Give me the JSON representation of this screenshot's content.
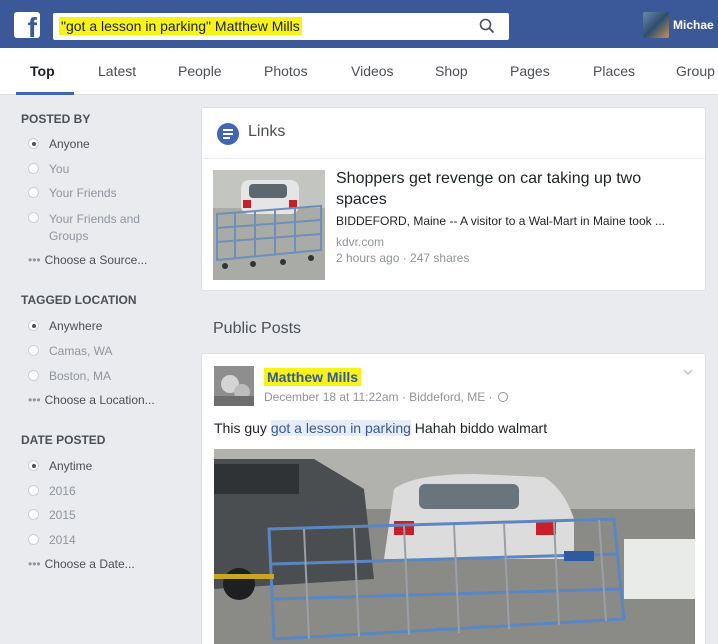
{
  "header": {
    "logo": "f",
    "search_query": "\"got a lesson in parking\" Matthew Mills",
    "profile_name": "Michae"
  },
  "tabs": [
    {
      "label": "Top",
      "active": true
    },
    {
      "label": "Latest"
    },
    {
      "label": "People"
    },
    {
      "label": "Photos"
    },
    {
      "label": "Videos"
    },
    {
      "label": "Shop"
    },
    {
      "label": "Pages"
    },
    {
      "label": "Places"
    },
    {
      "label": "Group"
    }
  ],
  "sidebar": {
    "posted_by": {
      "title": "POSTED BY",
      "options": [
        "Anyone",
        "You",
        "Your Friends",
        "Your Friends and Groups"
      ],
      "selected": "Anyone",
      "choose": "Choose a Source..."
    },
    "tagged_location": {
      "title": "TAGGED LOCATION",
      "options": [
        "Anywhere",
        "Camas, WA",
        "Boston, MA"
      ],
      "selected": "Anywhere",
      "choose": "Choose a Location..."
    },
    "date_posted": {
      "title": "DATE POSTED",
      "options": [
        "Anytime",
        "2016",
        "2015",
        "2014"
      ],
      "selected": "Anytime",
      "choose": "Choose a Date..."
    },
    "dots": "•••"
  },
  "links": {
    "title": "Links",
    "headline": "Shoppers get revenge on car taking up two spaces",
    "description": "BIDDEFORD, Maine -- A visitor to a Wal-Mart in Maine took ...",
    "domain": "kdvr.com",
    "meta": "2 hours ago · 247 shares"
  },
  "public_posts": {
    "title": "Public Posts",
    "author": "Matthew Mills",
    "meta": "December 18 at 11:22am · Biddeford, ME ·",
    "text_before": "This guy ",
    "text_highlight": "got a lesson in parking",
    "text_after": " Hahah biddo walmart"
  },
  "colors": {
    "brand": "#3b5998",
    "highlight": "#f7f316",
    "link": "#365899"
  }
}
